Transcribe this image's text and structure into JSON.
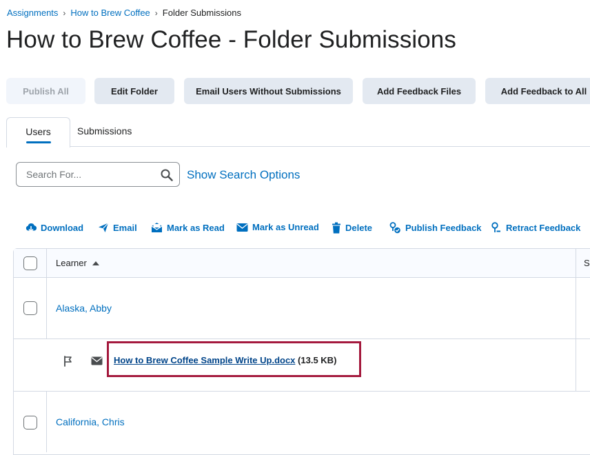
{
  "breadcrumb": {
    "items": [
      "Assignments",
      "How to Brew Coffee"
    ],
    "current": "Folder Submissions",
    "separator": "›"
  },
  "page": {
    "title": "How to Brew Coffee - Folder Submissions"
  },
  "toolbar": {
    "publish_all": "Publish All",
    "edit_folder": "Edit Folder",
    "email_users": "Email Users Without Submissions",
    "add_feedback_files": "Add Feedback Files",
    "add_feedback_all": "Add Feedback to All"
  },
  "tabs": [
    {
      "label": "Users",
      "selected": true
    },
    {
      "label": "Submissions",
      "selected": false
    }
  ],
  "search": {
    "placeholder": "Search For...",
    "value": "",
    "options_link": "Show Search Options"
  },
  "actions": {
    "download": "Download",
    "email": "Email",
    "mark_read": "Mark as Read",
    "mark_unread": "Mark as Unread",
    "delete": "Delete",
    "publish_feedback": "Publish Feedback",
    "retract_feedback": "Retract Feedback"
  },
  "table": {
    "headers": {
      "learner": "Learner",
      "next_col": "S"
    },
    "rows": [
      {
        "learner": "Alaska, Abby",
        "file": {
          "name": "How to Brew Coffee Sample Write Up.docx",
          "size": "(13.5 KB)"
        }
      },
      {
        "learner": "California, Chris"
      }
    ]
  },
  "colors": {
    "link": "#006fbf",
    "file_link": "#004489",
    "button_bg": "#e3e9f1",
    "highlight": "#a4193d"
  }
}
